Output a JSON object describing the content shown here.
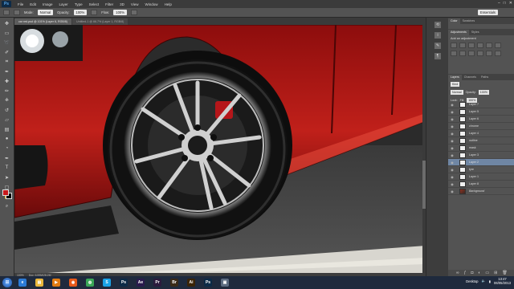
{
  "app": {
    "logo": "Ps",
    "menu": [
      "File",
      "Edit",
      "Image",
      "Layer",
      "Type",
      "Select",
      "Filter",
      "3D",
      "View",
      "Window",
      "Help"
    ]
  },
  "window_controls": [
    "–",
    "□",
    "✕"
  ],
  "options": {
    "mode_label": "Mode:",
    "mode_value": "Normal",
    "opacity_label": "Opacity:",
    "opacity_value": "100%",
    "flow_label": "Flow:",
    "flow_value": "100%",
    "workspace": "Essentials"
  },
  "tabs": [
    "car red.psd @ 101% (Layer 6, RGB/8)",
    "Untitled-1 @ 66.7% (Layer 1, RGB/8)"
  ],
  "status": {
    "zoom": "100%",
    "doc": "Doc: 6.59M/28.2M"
  },
  "tools": [
    "move",
    "marquee",
    "lasso",
    "quick-select",
    "crop",
    "eyedropper",
    "healing",
    "brush",
    "stamp",
    "history",
    "eraser",
    "gradient",
    "blur",
    "dodge",
    "pen",
    "type",
    "path-select",
    "shape",
    "hand",
    "zoom"
  ],
  "dock_icons": [
    "history-icon",
    "info-icon",
    "brush-preset-icon",
    "paragraph-icon"
  ],
  "panels": {
    "top_tabs": [
      "Color",
      "Swatches"
    ],
    "adj_tabs": [
      "Adjustments",
      "Styles"
    ],
    "adj_title": "Add an adjustment",
    "layers_tabs": [
      "Layers",
      "Channels",
      "Paths"
    ],
    "kind_label": "Kind",
    "blend_mode": "Normal",
    "opacity_label": "Opacity:",
    "opacity_value": "100%",
    "lock_label": "Lock:",
    "fill_label": "Fill:",
    "fill_value": "100%",
    "layers": [
      {
        "name": "Layer 7",
        "selected": false
      },
      {
        "name": "Layer 5",
        "selected": false
      },
      {
        "name": "Layer 6",
        "selected": false
      },
      {
        "name": "chrome",
        "selected": false
      },
      {
        "name": "Layer 4",
        "selected": false
      },
      {
        "name": "outline",
        "selected": false
      },
      {
        "name": "mask",
        "selected": false
      },
      {
        "name": "Layer 3",
        "selected": false
      },
      {
        "name": "Layer 2",
        "selected": true
      },
      {
        "name": "tyre",
        "selected": false
      },
      {
        "name": "Layer 1",
        "selected": false
      },
      {
        "name": "Layer 8",
        "selected": false
      },
      {
        "name": "Background",
        "selected": false,
        "background": true
      }
    ]
  },
  "taskbar": {
    "apps": [
      {
        "name": "ie",
        "label": "e",
        "color": "#2c7bd6"
      },
      {
        "name": "explorer",
        "label": "▤",
        "color": "#e9b73b"
      },
      {
        "name": "media",
        "label": "▶",
        "color": "#e07b12"
      },
      {
        "name": "firefox",
        "label": "◉",
        "color": "#e8591a"
      },
      {
        "name": "chrome",
        "label": "◍",
        "color": "#3aa757"
      },
      {
        "name": "skype",
        "label": "S",
        "color": "#1aa3e8"
      },
      {
        "name": "photoshop",
        "label": "Ps",
        "color": "#0d2b47"
      },
      {
        "name": "after-effects",
        "label": "Ae",
        "color": "#2a1b4d"
      },
      {
        "name": "premiere",
        "label": "Pr",
        "color": "#2b1b3d"
      },
      {
        "name": "bridge",
        "label": "Br",
        "color": "#3b2a17"
      },
      {
        "name": "illustrator",
        "label": "Ai",
        "color": "#3a2407"
      },
      {
        "name": "photoshop-2",
        "label": "Ps",
        "color": "#0d2b47"
      },
      {
        "name": "misc",
        "label": "▣",
        "color": "#5c6b80"
      }
    ],
    "tray_label": "Desktop",
    "time": "13:47",
    "date": "06/05/2013"
  }
}
